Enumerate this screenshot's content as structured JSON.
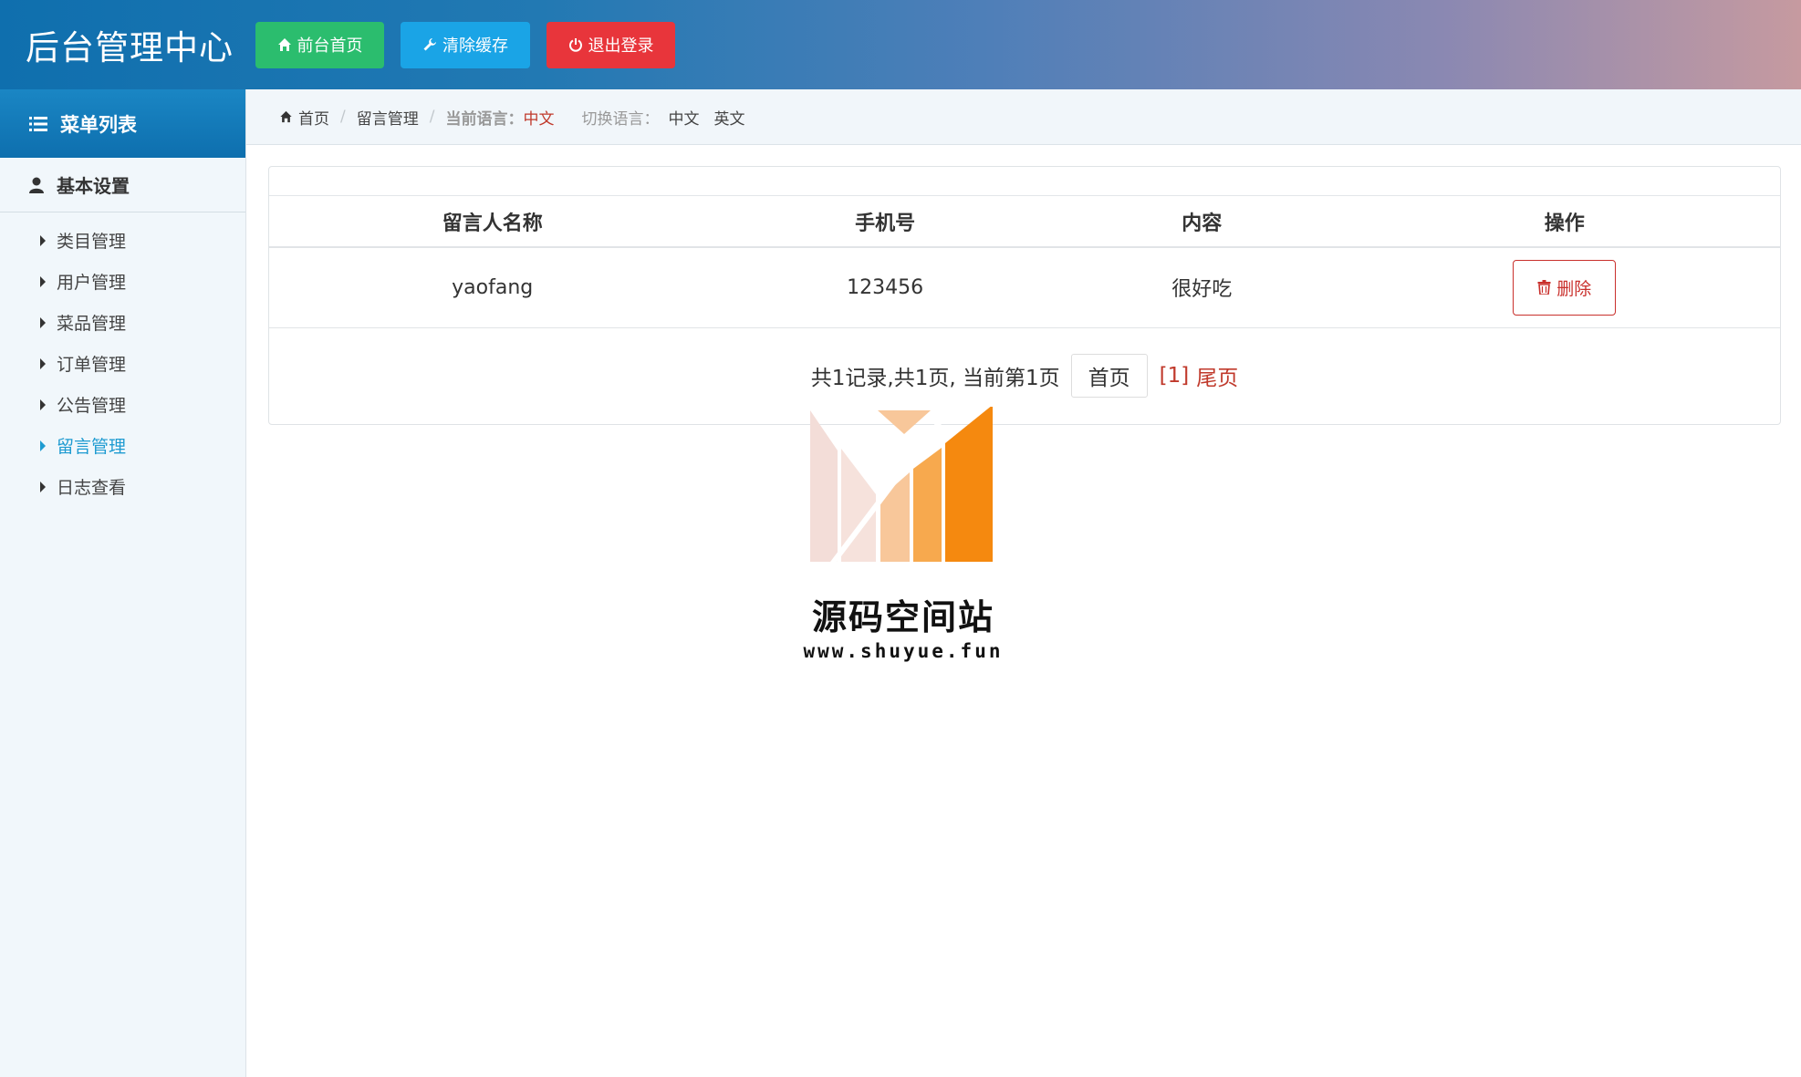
{
  "header": {
    "title": "后台管理中心",
    "buttons": {
      "home": "前台首页",
      "clear_cache": "清除缓存",
      "logout": "退出登录"
    }
  },
  "sidebar": {
    "menu_title": "菜单列表",
    "section_title": "基本设置",
    "items": [
      {
        "label": "类目管理",
        "active": false
      },
      {
        "label": "用户管理",
        "active": false
      },
      {
        "label": "菜品管理",
        "active": false
      },
      {
        "label": "订单管理",
        "active": false
      },
      {
        "label": "公告管理",
        "active": false
      },
      {
        "label": "留言管理",
        "active": true
      },
      {
        "label": "日志查看",
        "active": false
      }
    ]
  },
  "breadcrumb": {
    "home": "首页",
    "current": "留言管理",
    "lang_label": "当前语言：",
    "lang_value": "中文",
    "switch_label": "切换语言：",
    "switch_zh": "中文",
    "switch_en": "英文"
  },
  "table": {
    "headers": [
      "留言人名称",
      "手机号",
      "内容",
      "操作"
    ],
    "rows": [
      {
        "name": "yaofang",
        "phone": "123456",
        "content": "很好吃",
        "action": "删除"
      }
    ]
  },
  "pagination": {
    "summary": "共1记录,共1页, 当前第1页",
    "first": "首页",
    "current": "[1]",
    "last": "尾页"
  },
  "watermark": {
    "title": "源码空间站",
    "url": "www.shuyue.fun"
  },
  "colors": {
    "header_start": "#0f6fae",
    "green": "#2bbd6e",
    "blue": "#1aa4e6",
    "red": "#e8353b",
    "active": "#1e9bd1"
  }
}
